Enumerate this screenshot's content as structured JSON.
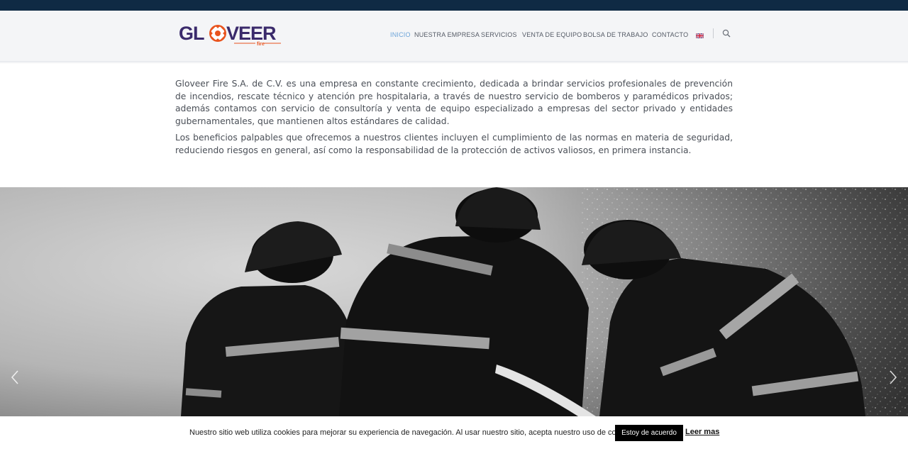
{
  "header": {
    "logo_text": "GLOVEER",
    "logo_sub": "fire",
    "brand_color": "#3a2a6b",
    "accent_color": "#e9541e",
    "nav": [
      {
        "label": "INICIO",
        "active": true
      },
      {
        "label": "NUESTRA EMPRESA",
        "active": false
      },
      {
        "label": "SERVICIOS",
        "active": false
      },
      {
        "label": "VENTA DE EQUIPO",
        "active": false
      },
      {
        "label": "BOLSA DE TRABAJO",
        "active": false
      },
      {
        "label": "CONTACTO",
        "active": false
      }
    ],
    "language_icon": "uk-flag-icon",
    "search_icon": "search-icon"
  },
  "intro": {
    "paragraph_1": "Gloveer Fire S.A. de C.V. es una empresa en constante crecimiento, dedicada a brindar servicios profesionales de prevención de incendios, rescate técnico y atención pre hospitalaria, a través de nuestro servicio de bomberos y paramédicos privados; además contamos con servicio de consultoría y venta de equipo especializado a empresas del sector privado y entidades gubernamentales, que mantienen altos estándares de calidad.",
    "paragraph_2": "Los beneficios palpables que ofrecemos a nuestros clientes incluyen el cumplimiento de las normas en materia de seguridad, reduciendo riesgos en general, así como la responsabilidad de la protección de activos valiosos, en primera instancia."
  },
  "slider": {
    "prev_icon": "chevron-left-icon",
    "next_icon": "chevron-right-icon"
  },
  "cookie": {
    "text": "Nuestro sitio web utiliza cookies para mejorar su experiencia de navegación. Al usar nuestro sitio, acepta nuestro uso de cookies.",
    "accept_label": "Estoy de acuerdo",
    "more_label": "Leer mas"
  }
}
